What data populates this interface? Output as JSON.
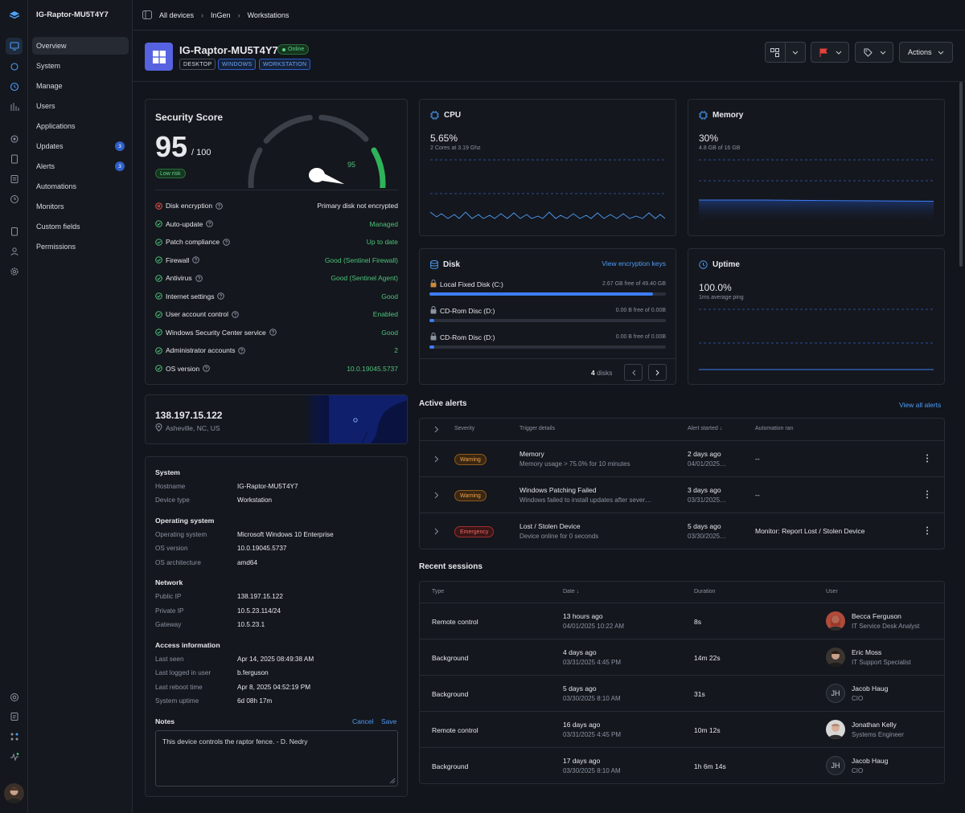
{
  "device": {
    "name": "IG-Raptor-MU5T4Y7",
    "status": "Online",
    "tags": [
      "DESKTOP",
      "WINDOWS",
      "WORKSTATION"
    ]
  },
  "breadcrumb": [
    "All devices",
    "InGen",
    "Workstations"
  ],
  "header": {
    "actions_label": "Actions"
  },
  "nav": {
    "items": [
      {
        "label": "Overview"
      },
      {
        "label": "System"
      },
      {
        "label": "Manage"
      },
      {
        "label": "Users"
      },
      {
        "label": "Applications"
      },
      {
        "label": "Updates",
        "badge": "3"
      },
      {
        "label": "Alerts",
        "badge": "3"
      },
      {
        "label": "Automations"
      },
      {
        "label": "Monitors"
      },
      {
        "label": "Custom fields"
      },
      {
        "label": "Permissions"
      }
    ]
  },
  "security": {
    "title": "Security Score",
    "score": "95",
    "max": "/ 100",
    "risk": "Low risk",
    "gauge_value": 95,
    "gauge_label": "95",
    "items": [
      {
        "label": "Disk encryption",
        "value": "Primary disk not encrypted",
        "ok": false
      },
      {
        "label": "Auto-update",
        "value": "Managed",
        "ok": true
      },
      {
        "label": "Patch compliance",
        "value": "Up to date",
        "ok": true
      },
      {
        "label": "Firewall",
        "value": "Good (Sentinel Firewall)",
        "ok": true
      },
      {
        "label": "Antivirus",
        "value": "Good (Sentinel Agent)",
        "ok": true
      },
      {
        "label": "Internet settings",
        "value": "Good",
        "ok": true
      },
      {
        "label": "User account control",
        "value": "Enabled",
        "ok": true
      },
      {
        "label": "Windows Security Center service",
        "value": "Good",
        "ok": true
      },
      {
        "label": "Administrator accounts",
        "value": "2",
        "ok": true
      },
      {
        "label": "OS version",
        "value": "10.0.19045.5737",
        "ok": true
      }
    ]
  },
  "location": {
    "ip": "138.197.15.122",
    "place": "Asheville, NC, US"
  },
  "info": {
    "system_title": "System",
    "hostname_k": "Hostname",
    "hostname": "IG-Raptor-MU5T4Y7",
    "devtype_k": "Device type",
    "devtype": "Workstation",
    "os_title": "Operating system",
    "os_k": "Operating system",
    "os": "Microsoft Windows 10 Enterprise",
    "osver_k": "OS version",
    "osver": "10.0.19045.5737",
    "arch_k": "OS architecture",
    "arch": "amd64",
    "net_title": "Network",
    "pubip_k": "Public IP",
    "pubip": "138.197.15.122",
    "privip_k": "Private IP",
    "privip": "10.5.23.114/24",
    "gw_k": "Gateway",
    "gw": "10.5.23.1",
    "access_title": "Access information",
    "lastseen_k": "Last seen",
    "lastseen": "Apr 14, 2025 08:49:38 AM",
    "lastuser_k": "Last logged in user",
    "lastuser": "b.ferguson",
    "reboot_k": "Last reboot time",
    "reboot": "Apr 8, 2025 04:52:19 PM",
    "uptime_k": "System uptime",
    "uptime": "6d 08h 17m"
  },
  "notes": {
    "title": "Notes",
    "cancel": "Cancel",
    "save": "Save",
    "text": "This device controls the raptor fence. - D. Nedry"
  },
  "cpu": {
    "title": "CPU",
    "value": "5.65%",
    "sub": "2 Cores at 3.19 Ghz"
  },
  "memory": {
    "title": "Memory",
    "value": "30%",
    "sub": "4.8 GB of 16 GB"
  },
  "disk": {
    "title": "Disk",
    "link": "View encryption keys",
    "count": "4",
    "count_label": "disks",
    "items": [
      {
        "name": "Local Fixed Disk (C:)",
        "info": "2.67 GB free of 49.40 GB",
        "used_pct": 94.6
      },
      {
        "name": "CD-Rom Disc (D:)",
        "info": "0.00 B free of 0.00B",
        "used_pct": 2
      },
      {
        "name": "CD-Rom Disc (D:)",
        "info": "0.00 B free of 0.00B",
        "used_pct": 2
      }
    ]
  },
  "uptime": {
    "title": "Uptime",
    "value": "100.0%",
    "sub": "1ms average ping"
  },
  "alerts": {
    "title": "Active alerts",
    "link": "View all alerts",
    "cols": [
      "Severity",
      "Trigger details",
      "Alert started",
      "Automation ran"
    ],
    "rows": [
      {
        "severity": "Warning",
        "title": "Memory",
        "detail": "Memory usage > 75.0% for 10 minutes",
        "started": "2 days ago",
        "date": "04/01/2025…",
        "automation": "--"
      },
      {
        "severity": "Warning",
        "title": "Windows Patching Failed",
        "detail": "Windows failed to install updates after sever…",
        "started": "3 days ago",
        "date": "03/31/2025…",
        "automation": "--"
      },
      {
        "severity": "Emergency",
        "title": "Lost / Stolen Device",
        "detail": "Device online for 0 seconds",
        "started": "5 days ago",
        "date": "03/30/2025…",
        "automation": "Monitor: Report Lost / Stolen Device"
      }
    ]
  },
  "sessions": {
    "title": "Recent sessions",
    "cols": [
      "Type",
      "Date",
      "Duration",
      "User"
    ],
    "rows": [
      {
        "type": "Remote control",
        "ago": "13 hours ago",
        "date": "04/01/2025 10:22 AM",
        "duration": "8s",
        "user": "Becca Ferguson",
        "role": "IT Service Desk Analyst",
        "initials": ""
      },
      {
        "type": "Background",
        "ago": "4 days ago",
        "date": "03/31/2025 4:45 PM",
        "duration": "14m 22s",
        "user": "Eric Moss",
        "role": "IT Support Specialist",
        "initials": ""
      },
      {
        "type": "Background",
        "ago": "5 days ago",
        "date": "03/30/2025 8:10 AM",
        "duration": "31s",
        "user": "Jacob Haug",
        "role": "CIO",
        "initials": "JH"
      },
      {
        "type": "Remote control",
        "ago": "16 days ago",
        "date": "03/31/2025 4:45 PM",
        "duration": "10m 12s",
        "user": "Jonathan Kelly",
        "role": "Systems Engineer",
        "initials": ""
      },
      {
        "type": "Background",
        "ago": "17 days ago",
        "date": "03/30/2025 8:10 AM",
        "duration": "1h 6m 14s",
        "user": "Jacob Haug",
        "role": "CIO",
        "initials": "JH"
      }
    ]
  }
}
